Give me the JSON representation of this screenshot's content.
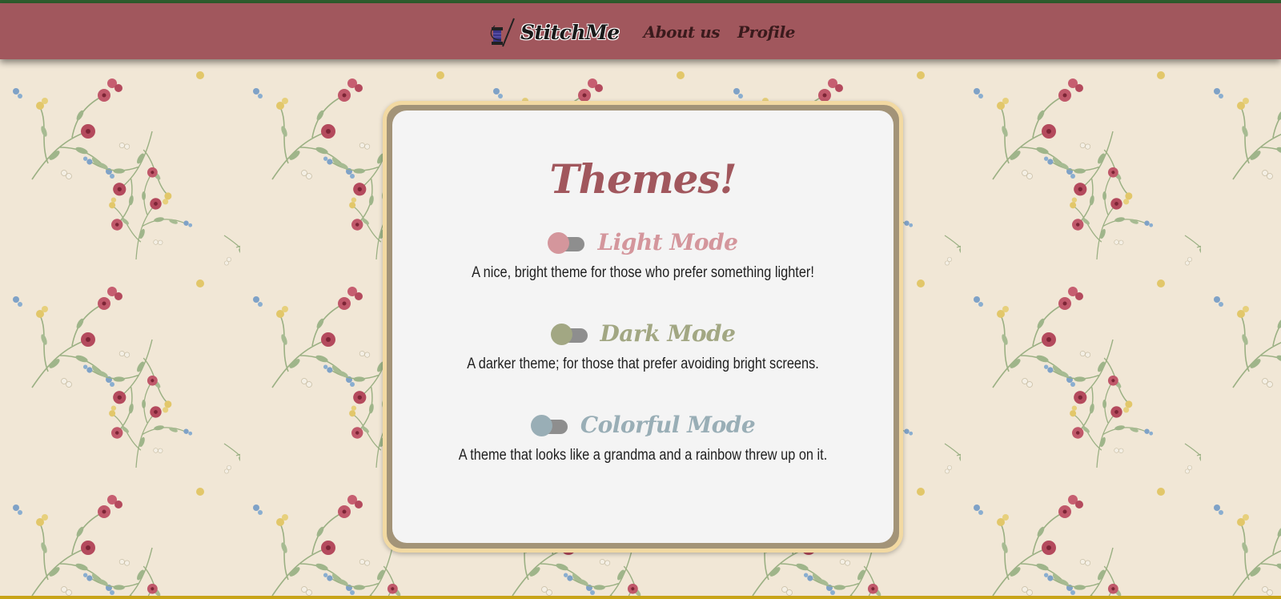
{
  "header": {
    "brand_name": "StitchMe",
    "brand_icon": "needle-thread-spool-icon",
    "links": [
      {
        "label": "About us"
      },
      {
        "label": "Profile"
      }
    ]
  },
  "themes_card": {
    "title": "Themes!",
    "themes": [
      {
        "name": "Light Mode",
        "description": "A nice, bright theme for those who prefer something lighter!",
        "accent": "#d4969c",
        "toggle_on": false
      },
      {
        "name": "Dark Mode",
        "description": "A darker theme; for those that prefer avoiding bright screens.",
        "accent": "#a2a783",
        "toggle_on": false
      },
      {
        "name": "Colorful Mode",
        "description": "A theme that looks like a grandma and a rainbow threw up on it.",
        "accent": "#99aeb6",
        "toggle_on": false
      }
    ]
  },
  "colors": {
    "nav_background": "#a1575d",
    "top_accent": "#2e5e2e",
    "bottom_accent": "#c8a418",
    "wallpaper_background": "#f1e7d6",
    "card_background": "#f4f4f4",
    "card_frame": "#a39478",
    "card_frame_border": "#f2d9a2",
    "title_color": "#a1575d"
  }
}
